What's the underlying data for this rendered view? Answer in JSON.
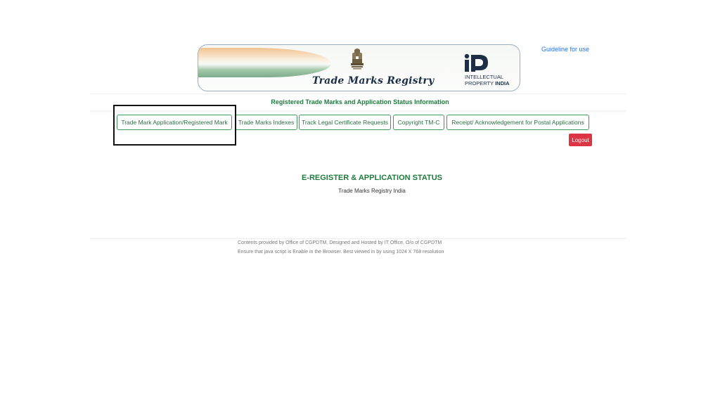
{
  "header": {
    "guideline_link": "Guideline for use",
    "banner_title": "Trade Marks Registry",
    "ip_logo_line1": "INTELLECTUAL",
    "ip_logo_line2_a": "PROPERTY",
    "ip_logo_line2_b": "INDIA",
    "subtitle": "Registered Trade Marks and Application Status Information"
  },
  "nav": {
    "items": [
      {
        "label": "Trade Mark Application/Registered Mark"
      },
      {
        "label": "Trade Marks Indexes"
      },
      {
        "label": "Track Legal Certificate Requests"
      },
      {
        "label": "Copyright TM-C"
      },
      {
        "label": "Receipt/ Acknowledgement for Postal Applications"
      }
    ],
    "logout_label": "Logout"
  },
  "main": {
    "heading": "E-REGISTER & APPLICATION STATUS",
    "subheading": "Trade Marks Registry India"
  },
  "footer": {
    "line1": "Contents provided by Office of CGPDTM, Designed and Hosted by IT Office, O/o of CGPDTM",
    "line2": "Ensure that java script is Enable in the Browser. Best viewed in by using 1024 X 768 resolution"
  },
  "colors": {
    "accent_green": "#1e7a3c",
    "button_border": "#3d9a5a",
    "logout_red": "#dc3545",
    "link_blue": "#1a73e8"
  },
  "icons": [
    "national-emblem-icon",
    "ip-india-logo-icon"
  ]
}
